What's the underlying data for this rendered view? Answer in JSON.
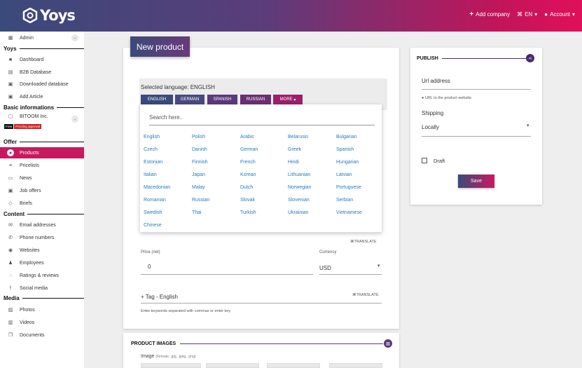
{
  "topbar": {
    "logo": "Yoys",
    "add_company": "Add company",
    "language": "EN",
    "account": "Account"
  },
  "sidebar": {
    "admin": "Admin",
    "sections": {
      "yoys": "Yoys",
      "basic": "Basic informations",
      "offer": "Offer",
      "content": "Content",
      "media": "Media"
    },
    "yoys_items": [
      "Dashboard",
      "B2B Database",
      "Downloaded database",
      "Add Article"
    ],
    "company": "BITOOM Inc.",
    "badge_free": "Free",
    "badge_pending": "Pending approval",
    "offer_items": [
      "Products",
      "Pricelists",
      "News",
      "Job offers",
      "Briefs"
    ],
    "content_items": [
      "Email addresses",
      "Phone numbers",
      "Websites",
      "Employees",
      "Ratings & reviews",
      "Social media"
    ],
    "media_items": [
      "Photos",
      "Videos",
      "Documents"
    ]
  },
  "main": {
    "new_product": "New product",
    "selected_language": "Selected language: ENGLISH",
    "lang_tabs": [
      "ENGLISH",
      "GERMAN",
      "SPANISH",
      "RUSSIAN",
      "MORE"
    ],
    "search_placeholder": "Search here..",
    "languages": [
      [
        "English",
        "Polish",
        "Arabic",
        "Belarusin",
        "Bulgarian"
      ],
      [
        "Czech",
        "Danish",
        "German",
        "Greek",
        "Spanish"
      ],
      [
        "Estonian",
        "Finnish",
        "French",
        "Hindi",
        "Hungarian"
      ],
      [
        "Italian",
        "Japan",
        "Korean",
        "Lithuanian",
        "Latvian"
      ],
      [
        "Macedonian",
        "Malay",
        "Dutch",
        "Norwegian",
        "Portuguese"
      ],
      [
        "Romanian",
        "Russian",
        "Slovak",
        "Slovenian",
        "Serbian"
      ],
      [
        "Swedish",
        "Thai",
        "Turkish",
        "Ukrainian",
        "Vietnamese"
      ],
      [
        "Chinese"
      ]
    ],
    "translate": "TRANSLATE",
    "price_label": "Price (net)",
    "price_value": "0",
    "currency_label": "Currency",
    "currency_value": "USD",
    "tag_label": "+ Tag - English",
    "tag_hint": "Enter keywords separated with commas or enter key",
    "product_images_title": "PRODUCT IMAGES",
    "image_label": "Image",
    "image_formats": "(formats: .jpg, .jpeg, .png)"
  },
  "publish": {
    "title": "PUBLISH",
    "url_label": "Url address",
    "url_hint": "URL to the product website",
    "shipping_label": "Shipping",
    "shipping_value": "Locally",
    "draft_label": "Draft",
    "save": "Save"
  },
  "colors": {
    "accent": "#c8195e",
    "brand_dark": "#3a4a7a",
    "link": "#2a7ac0"
  }
}
